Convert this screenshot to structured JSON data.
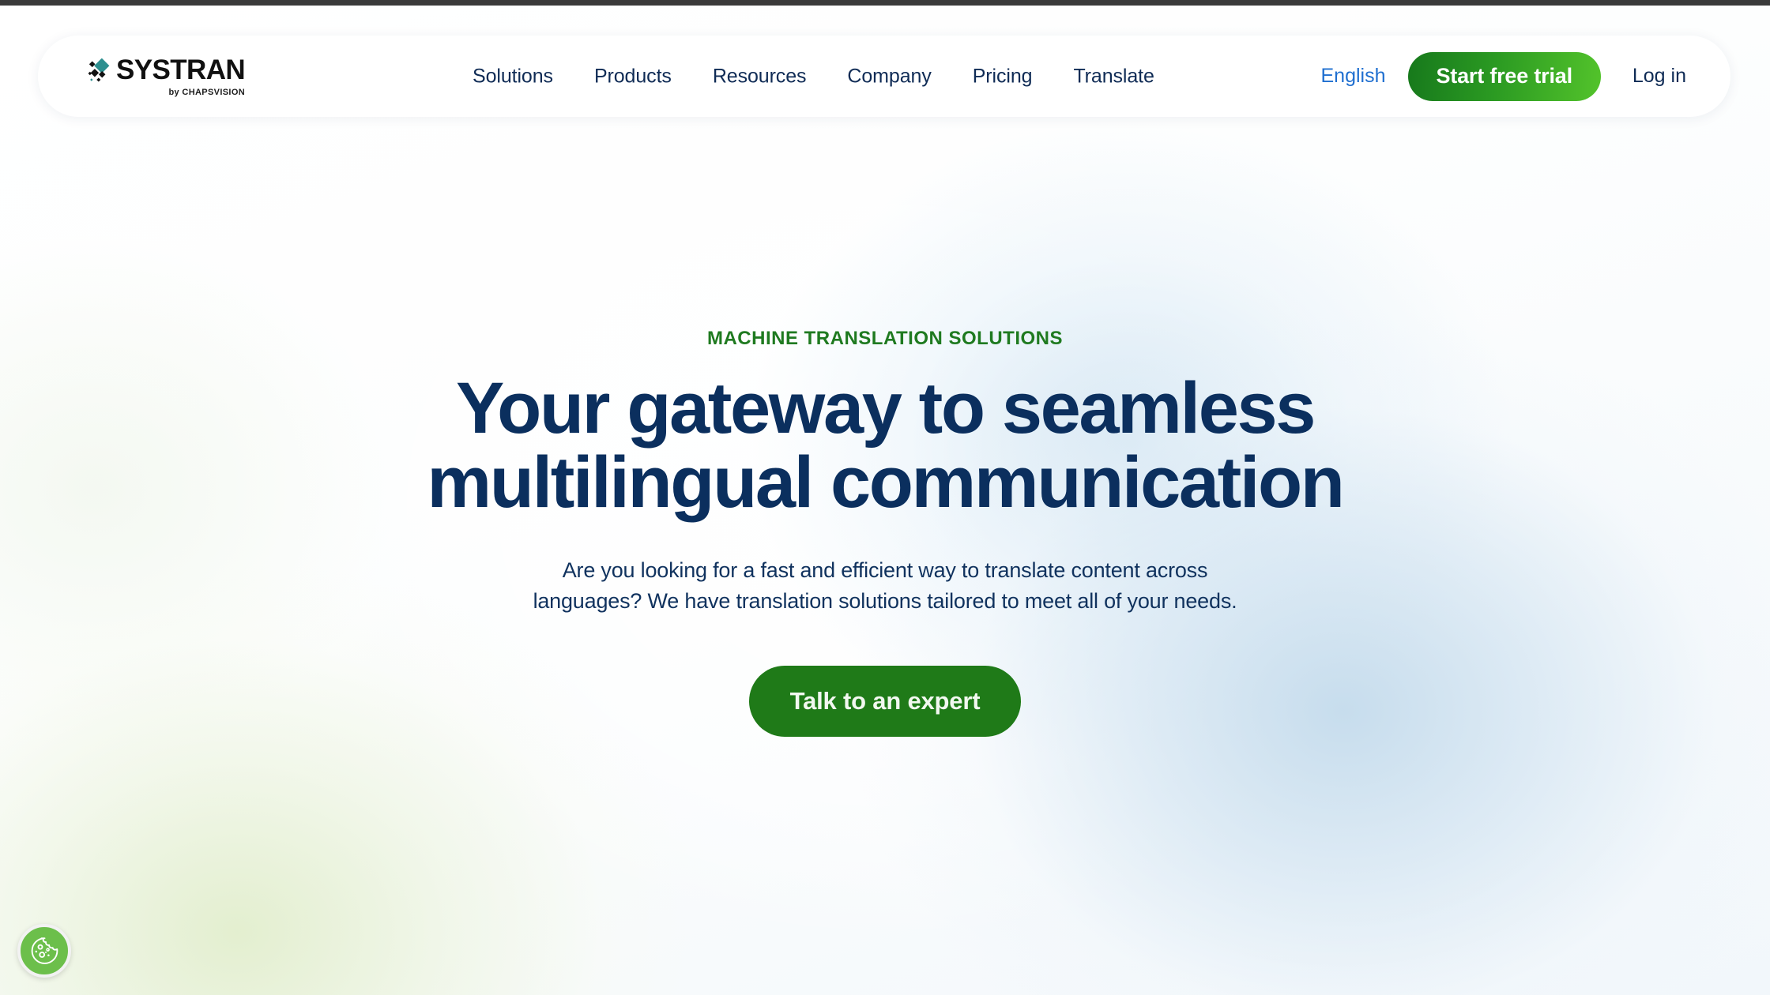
{
  "site": {
    "brand_name": "SYSTRAN",
    "brand_tagline": "by CHAPSVISION"
  },
  "colors": {
    "navy": "#0b2f5e",
    "green_accent": "#1f7a20",
    "link_blue": "#1f6fd0",
    "trial_gradient_start": "#17791c",
    "trial_gradient_end": "#53c32b",
    "cta_green": "#1f7a18",
    "cookie_green": "#6cbf4b",
    "logo_diamond_teal": "#2d8f8f"
  },
  "header": {
    "nav": [
      {
        "label": "Solutions"
      },
      {
        "label": "Products"
      },
      {
        "label": "Resources"
      },
      {
        "label": "Company"
      },
      {
        "label": "Pricing"
      },
      {
        "label": "Translate"
      }
    ],
    "language": "English",
    "trial_button": "Start free trial",
    "login_link": "Log in"
  },
  "hero": {
    "eyebrow": "MACHINE TRANSLATION SOLUTIONS",
    "headline": "Your gateway to seamless multilingual communication",
    "subheadline": "Are you looking for a fast and efficient way to translate content across languages? We have translation solutions tailored to meet all of your needs.",
    "cta_label": "Talk to an expert"
  },
  "cookie_widget": {
    "icon": "cookie-icon"
  }
}
